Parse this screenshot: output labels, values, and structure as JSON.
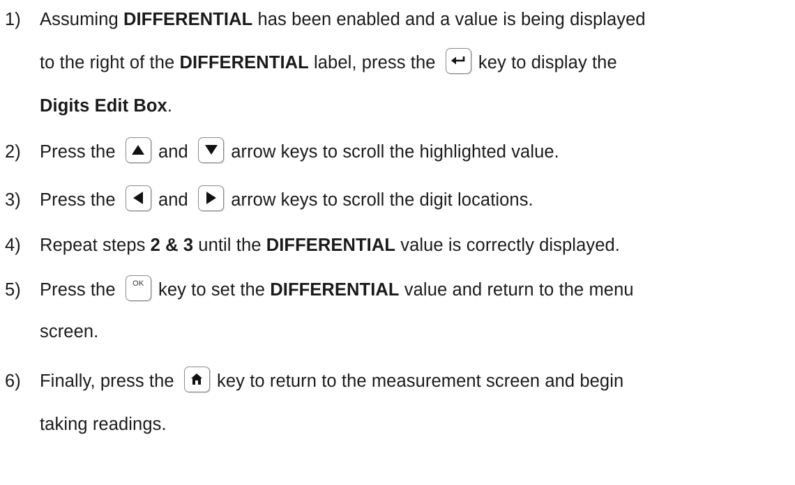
{
  "steps": [
    {
      "num": "1)",
      "line1_a": "Assuming ",
      "line1_b": "DIFFERENTIAL",
      "line1_c": " has been enabled and a value is being displayed",
      "line2_a": "to the right of the ",
      "line2_b": "DIFFERENTIAL",
      "line2_c": " label, press the ",
      "key": "enter-icon",
      "line2_d": " key to display the",
      "line3_b": "Digits Edit Box",
      "line3_c": "."
    },
    {
      "num": "2)",
      "a": "Press the ",
      "key1": "up-arrow-icon",
      "b": " and ",
      "key2": "down-arrow-icon",
      "c": " arrow keys to scroll the highlighted value."
    },
    {
      "num": "3)",
      "a": "Press the ",
      "key1": "left-arrow-icon",
      "b": " and ",
      "key2": "right-arrow-icon",
      "c": " arrow keys to scroll the digit locations."
    },
    {
      "num": "4)",
      "a": "Repeat steps ",
      "b": "2 & 3",
      "c": " until the ",
      "d": "DIFFERENTIAL",
      "e": " value is correctly displayed."
    },
    {
      "num": "5)",
      "a": "Press the ",
      "key_label": "OK",
      "b": " key to set the ",
      "c": "DIFFERENTIAL",
      "d": " value and return to the menu",
      "line2": "screen."
    },
    {
      "num": "6)",
      "a": "Finally, press the ",
      "key": "home-icon",
      "b": " key to return to the measurement screen and begin",
      "line2": "taking readings."
    }
  ]
}
